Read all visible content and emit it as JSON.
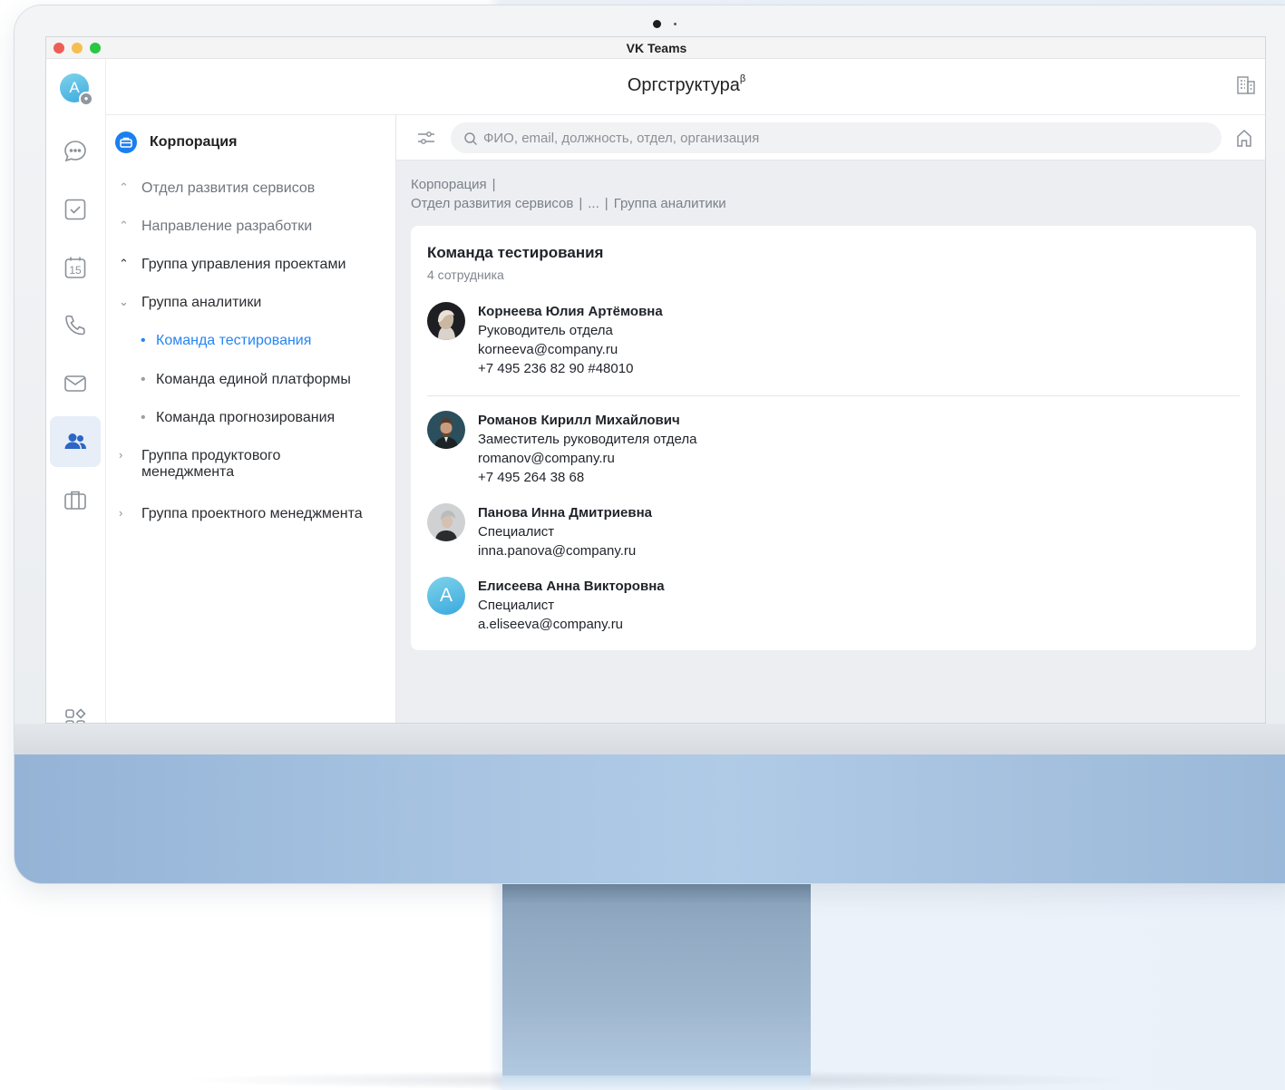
{
  "window": {
    "title": "VK Teams"
  },
  "rail": {
    "avatar_letter": "A",
    "items": [
      {
        "icon": "chat-icon"
      },
      {
        "icon": "tasks-icon"
      },
      {
        "icon": "calendar-icon",
        "day": "15"
      },
      {
        "icon": "phone-icon"
      },
      {
        "icon": "mail-icon"
      },
      {
        "icon": "contacts-icon",
        "active": true
      },
      {
        "icon": "briefcase-icon"
      },
      {
        "icon": "apps-icon"
      }
    ]
  },
  "header": {
    "title": "Оргструктура",
    "title_sup": "β"
  },
  "tree": {
    "root": "Корпорация",
    "items": [
      {
        "label": "Отдел развития сервисов",
        "state": "ancestor"
      },
      {
        "label": "Направление разработки",
        "state": "ancestor"
      },
      {
        "label": "Группа управления проектами",
        "state": "ancestor-strong"
      },
      {
        "label": "Группа аналитики",
        "state": "expanded"
      },
      {
        "label": "Команда тестирования",
        "state": "selected"
      },
      {
        "label": "Команда единой платформы",
        "state": "leaf"
      },
      {
        "label": "Команда прогнозирования",
        "state": "leaf"
      },
      {
        "label_line1": "Группа продуктового",
        "label_line2": "менеджмента",
        "state": "collapsed"
      },
      {
        "label": "Группа проектного менеджмента",
        "state": "collapsed"
      }
    ]
  },
  "search": {
    "placeholder": "ФИО, email, должность, отдел, организация"
  },
  "breadcrumb": {
    "line1": "Корпорация",
    "line2": [
      "Отдел развития сервисов",
      "...",
      "Группа аналитики"
    ]
  },
  "team": {
    "title": "Команда тестирования",
    "count": "4 сотрудника",
    "members": [
      {
        "name": "Корнеева Юлия Артёмовна",
        "position": "Руководитель отдела",
        "email": "korneeva@company.ru",
        "phone": "+7 495 236 82 90 #48010"
      },
      {
        "name": "Романов Кирилл Михайлович",
        "position": "Заместитель руководителя отдела",
        "email": "romanov@company.ru",
        "phone": "+7 495 264 38 68"
      },
      {
        "name": "Панова Инна Дмитриевна",
        "position": "Специалист",
        "email": "inna.panova@company.ru"
      },
      {
        "name": "Елисеева Анна Викторовна",
        "position": "Специалист",
        "email": "a.eliseeva@company.ru",
        "avatar_letter": "A"
      }
    ]
  },
  "colors": {
    "accent": "#2685f0",
    "root_icon": "#1b7ff0",
    "content_bg": "#eceef2",
    "monitor_chin": "#a8c4e2"
  }
}
